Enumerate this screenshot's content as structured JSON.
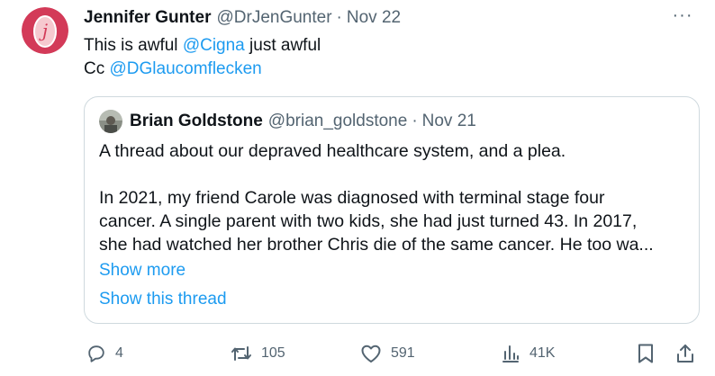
{
  "tweet": {
    "author_name": "Jennifer Gunter",
    "author_handle": "@DrJenGunter",
    "dot": "·",
    "date": "Nov 22",
    "more_label": "···",
    "line1_text": "This is awful ",
    "line1_mention": "@Cigna",
    "line1_rest": " just awful",
    "line2_text": "Cc ",
    "line2_mention": "@DGlaucomflecken"
  },
  "quote": {
    "author_name": "Brian Goldstone",
    "author_handle": "@brian_goldstone",
    "dot": "·",
    "date": "Nov 21",
    "line1": "A thread about our depraved healthcare system, and a plea.",
    "line2": "In 2021, my friend Carole was diagnosed with terminal stage four",
    "line3": "cancer. A single parent with two kids, she had just turned 43. In 2017,",
    "line4": "she had watched her brother Chris die of the same cancer. He too wa...",
    "show_more": "Show more",
    "show_thread": "Show this thread"
  },
  "actions": {
    "replies": "4",
    "retweets": "105",
    "likes": "591",
    "views": "41K"
  },
  "colors": {
    "accent": "#1d9bf0",
    "secondary_text": "#536471",
    "border": "#cfd9de",
    "avatar_bg": "#d33a58"
  },
  "icons": [
    "reply-icon",
    "retweet-icon",
    "like-icon",
    "views-icon",
    "bookmark-icon",
    "share-icon",
    "more-icon"
  ]
}
